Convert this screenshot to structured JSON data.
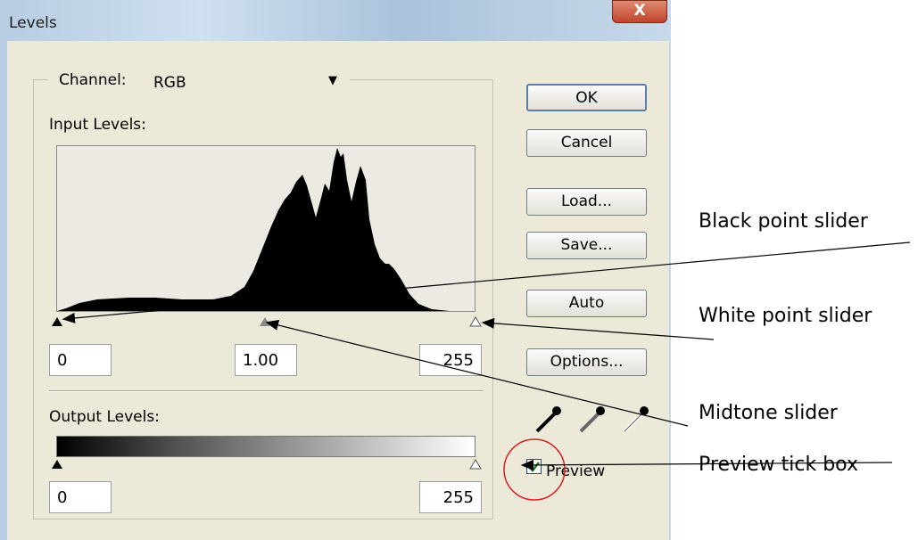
{
  "window": {
    "title": "Levels",
    "close_label": "X"
  },
  "channel": {
    "label": "Channel:",
    "value": "RGB"
  },
  "input_levels": {
    "label": "Input Levels:",
    "black": "0",
    "mid": "1.00",
    "white": "255"
  },
  "output_levels": {
    "label": "Output Levels:",
    "black": "0",
    "white": "255"
  },
  "buttons": {
    "ok": "OK",
    "cancel": "Cancel",
    "load": "Load...",
    "save": "Save...",
    "auto": "Auto",
    "options": "Options..."
  },
  "preview": {
    "label": "Preview",
    "checked": true
  },
  "annotations": {
    "black_point": "Black point slider",
    "white_point": "White point slider",
    "midtone": "Midtone slider",
    "preview": "Preview tick box"
  },
  "colors": {
    "highlight_circle": "#d92020"
  }
}
